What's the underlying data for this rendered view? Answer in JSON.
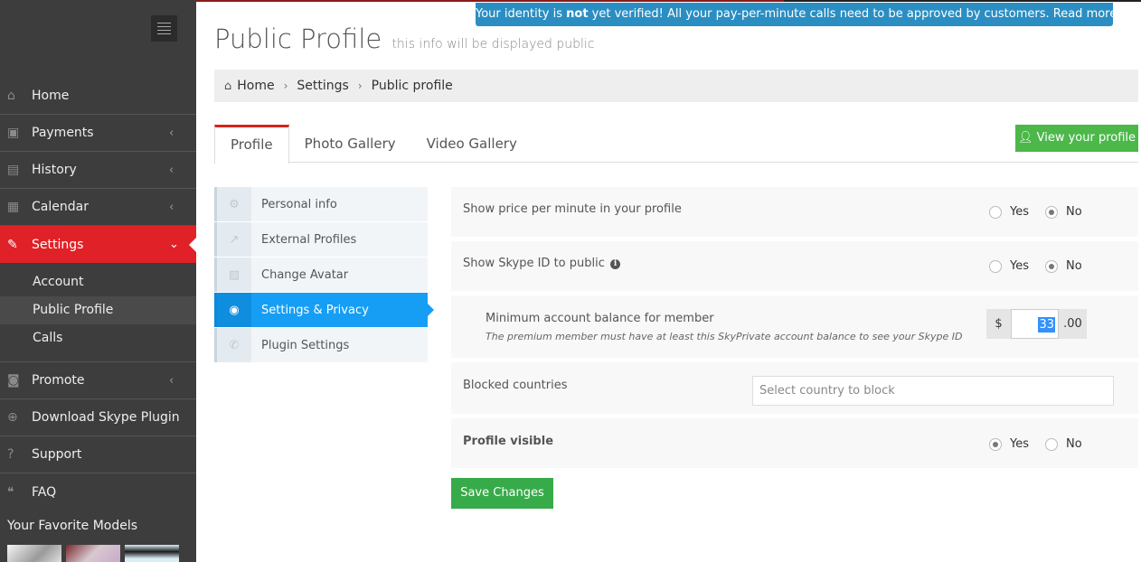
{
  "sidebar": {
    "nav": [
      {
        "label": "Home",
        "icon": "home-icon",
        "glyph": "⌂",
        "chevron": ""
      },
      {
        "label": "Payments",
        "icon": "money-icon",
        "glyph": "▣",
        "chevron": "‹"
      },
      {
        "label": "History",
        "icon": "book-icon",
        "glyph": "▤",
        "chevron": "‹"
      },
      {
        "label": "Calendar",
        "icon": "calendar-icon",
        "glyph": "▦",
        "chevron": "‹"
      },
      {
        "label": "Settings",
        "icon": "wrench-icon",
        "glyph": "✎",
        "chevron": "⌄"
      }
    ],
    "settings_sub": [
      "Account",
      "Public Profile",
      "Calls"
    ],
    "nav2": [
      {
        "label": "Promote",
        "icon": "camera-icon",
        "glyph": "◙",
        "chevron": "‹"
      },
      {
        "label": "Download Skype Plugin",
        "icon": "download-icon",
        "glyph": "⊕",
        "chevron": ""
      },
      {
        "label": "Support",
        "icon": "question-icon",
        "glyph": "?",
        "chevron": ""
      },
      {
        "label": "FAQ",
        "icon": "comments-icon",
        "glyph": "❝",
        "chevron": ""
      }
    ],
    "favorites_title": "Your Favorite Models"
  },
  "alert": {
    "before": "Your identity is ",
    "bold": "not",
    "after": " yet verified! All your pay-per-minute calls need to be approved by customers. Read more here!"
  },
  "header": {
    "title": "Public Profile",
    "subtitle": "this info will be displayed public"
  },
  "breadcrumb": [
    "Home",
    "Settings",
    "Public profile"
  ],
  "tabs": [
    "Profile",
    "Photo Gallery",
    "Video Gallery"
  ],
  "view_profile_label": "View your profile",
  "side_tabs": [
    {
      "label": "Personal info",
      "glyph": "⚙"
    },
    {
      "label": "External Profiles",
      "glyph": "↗"
    },
    {
      "label": "Change Avatar",
      "glyph": "▨"
    },
    {
      "label": "Settings & Privacy",
      "glyph": "◉"
    },
    {
      "label": "Plugin Settings",
      "glyph": "✆"
    }
  ],
  "form": {
    "show_price": {
      "label": "Show price per minute in your profile",
      "yes": "Yes",
      "no": "No",
      "selected": "No"
    },
    "show_skype": {
      "label": "Show Skype ID to public",
      "yes": "Yes",
      "no": "No",
      "selected": "No"
    },
    "min_balance": {
      "label": "Minimum account balance for member",
      "help": "The premium member must have at least this SkyPrivate account balance to see your Skype ID",
      "prefix": "$",
      "value": "33",
      "suffix": ".00"
    },
    "blocked_countries": {
      "label": "Blocked countries",
      "placeholder": "Select country to block"
    },
    "profile_visible": {
      "label": "Profile visible",
      "yes": "Yes",
      "no": "No",
      "selected": "Yes"
    },
    "save_label": "Save Changes"
  }
}
